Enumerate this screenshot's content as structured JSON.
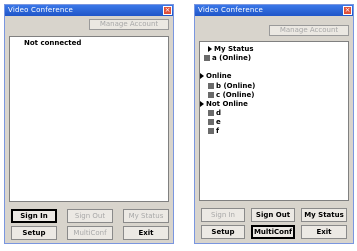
{
  "left": {
    "title": "Video Conference",
    "manage_account": "Manage Account",
    "status": "Not connected",
    "buttons": {
      "sign_in": "Sign In",
      "sign_out": "Sign Out",
      "my_status": "My Status",
      "setup": "Setup",
      "multiconf": "MultiConf",
      "exit": "Exit"
    }
  },
  "right": {
    "title": "Video Conference",
    "manage_account": "Manage Account",
    "tree": {
      "my_status_header": "My Status",
      "self": "a (Online)",
      "online_group": "Online",
      "online": [
        "b (Online)",
        "c (Online)"
      ],
      "offline_group": "Not Online",
      "offline": [
        "d",
        "e",
        "f"
      ]
    },
    "buttons": {
      "sign_in": "Sign In",
      "sign_out": "Sign Out",
      "my_status": "My Status",
      "setup": "Setup",
      "multiconf": "MultiConf",
      "exit": "Exit"
    }
  }
}
